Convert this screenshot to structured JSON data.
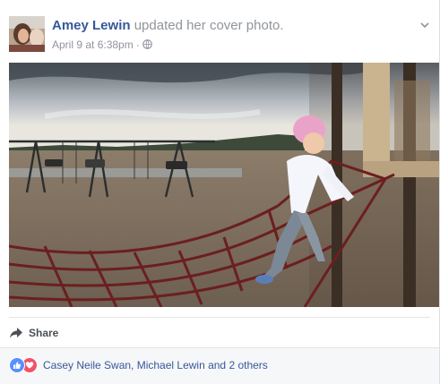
{
  "post": {
    "author": "Amey Lewin",
    "action": "updated her cover photo.",
    "date": "April 9 at 6:38pm",
    "separator": "·",
    "privacy_icon": "globe-icon",
    "options_icon": "chevron-down-icon"
  },
  "actions": {
    "share_label": "Share",
    "share_icon": "share-arrow-icon"
  },
  "reactions": {
    "icons": [
      "like-icon",
      "love-icon"
    ],
    "summary": "Casey Neile Swan, Michael Lewin and 2 others"
  },
  "colors": {
    "link": "#365899",
    "secondary_text": "#90949c",
    "like_blue": "#5890ff",
    "love_red": "#f25268",
    "footer_bg": "#f6f7f9"
  }
}
